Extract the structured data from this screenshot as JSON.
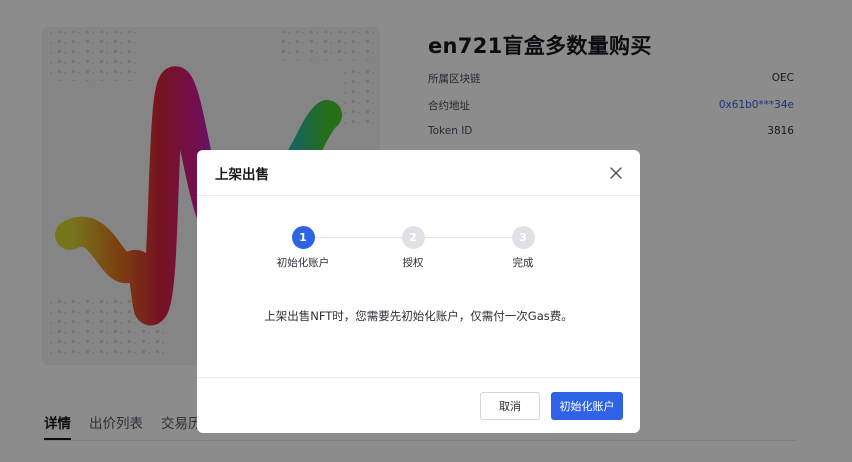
{
  "nft": {
    "title": "en721盲盒多数量购买",
    "image_icon": "nft-wave-artwork"
  },
  "info": [
    {
      "label": "所属区块链",
      "value": "OEC",
      "is_link": false
    },
    {
      "label": "合约地址",
      "value": "0x61b0***34e",
      "is_link": true
    },
    {
      "label": "Token ID",
      "value": "3816",
      "is_link": false
    }
  ],
  "tabs": [
    {
      "label": "详情",
      "active": true
    },
    {
      "label": "出价列表",
      "active": false
    },
    {
      "label": "交易历",
      "active": false
    }
  ],
  "modal": {
    "title": "上架出售",
    "close_icon": "close-icon",
    "steps": [
      {
        "number": "1",
        "label": "初始化账户",
        "active": true
      },
      {
        "number": "2",
        "label": "授权",
        "active": false
      },
      {
        "number": "3",
        "label": "完成",
        "active": false
      }
    ],
    "message": "上架出售NFT时，您需要先初始化账户，仅需付一次Gas费。",
    "cancel_label": "取消",
    "confirm_label": "初始化账户"
  },
  "colors": {
    "primary": "#2f63e6",
    "mask": "rgba(0,0,0,0.45)",
    "step_inactive": "#dfe1e6"
  }
}
